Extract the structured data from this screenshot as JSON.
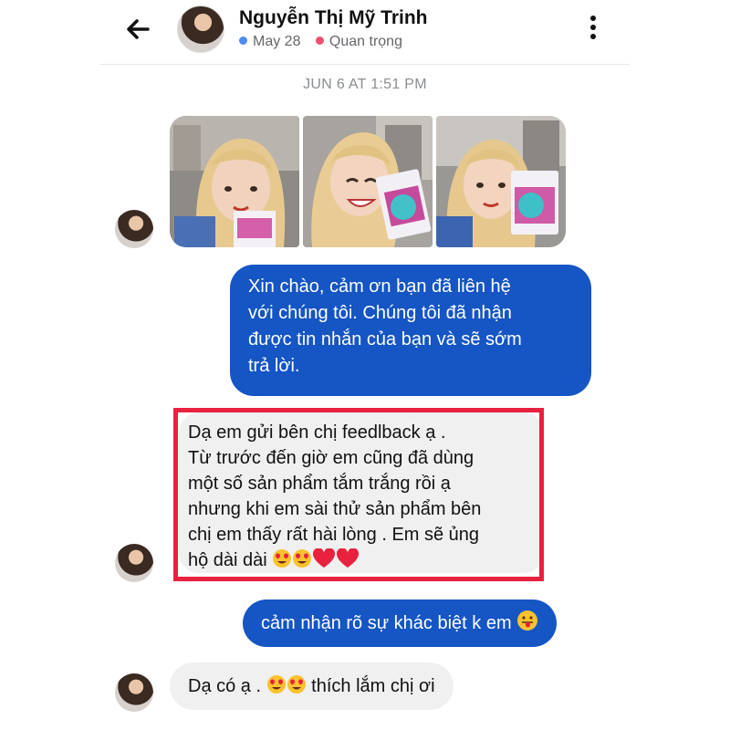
{
  "header": {
    "contact_name": "Nguyễn Thị Mỹ Trinh",
    "tags": [
      {
        "label": "May 28",
        "color": "#4c8bf5"
      },
      {
        "label": "Quan trọng",
        "color": "#f0506e"
      }
    ],
    "icons": {
      "back": "arrow-left-icon",
      "menu": "kebab-menu-icon"
    }
  },
  "conversation": {
    "timestamp": "JUN 6 AT 1:51 PM",
    "photo_count": 3,
    "messages": [
      {
        "direction": "outgoing",
        "text": "Xin chào, cảm ơn bạn đã liên hệ\nvới chúng tôi. Chúng tôi đã nhận\nđược tin nhắn của bạn và sẽ sớm\ntrả lời."
      },
      {
        "direction": "incoming",
        "text": "Dạ em gửi bên chị feedlback ạ .\nTừ trước đến giờ em cũng đã dùng\nmột số sản phẩm tắm trắng rồi ạ\nnhưng khi em sài thử sản phẩm bên\nchị em thấy rất hài lòng . Em sẽ ủng\nhộ dài dài",
        "emojis": [
          "heart-eyes-emoji",
          "heart-eyes-emoji",
          "red-heart-emoji",
          "red-heart-emoji"
        ],
        "highlighted": true
      },
      {
        "direction": "outgoing",
        "text": "cảm nhận rõ sự khác biệt k em",
        "emojis": [
          "tongue-out-emoji"
        ]
      },
      {
        "direction": "incoming",
        "text_before": "Dạ có ạ .",
        "emojis": [
          "heart-eyes-emoji",
          "heart-eyes-emoji"
        ],
        "text_after": "thích lắm chị ơi"
      }
    ]
  },
  "colors": {
    "outgoing_bubble": "#1555c4",
    "incoming_bubble": "#f0f0f0",
    "highlight_border": "#e8213f"
  }
}
